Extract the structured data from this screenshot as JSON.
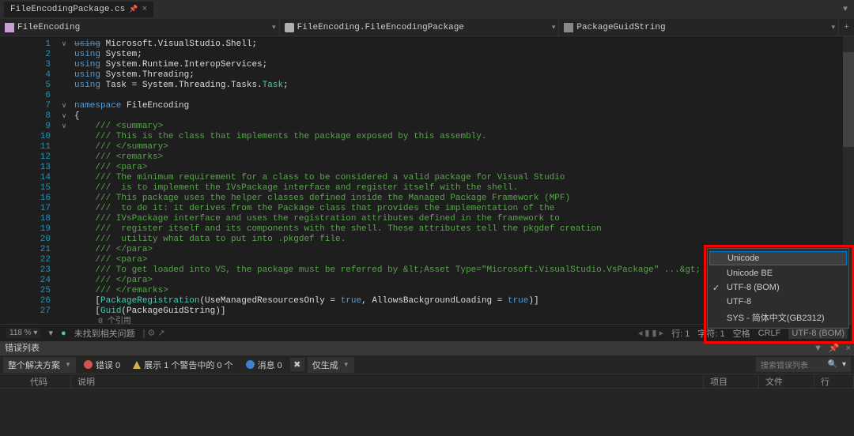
{
  "tab": {
    "name": "FileEncodingPackage.cs"
  },
  "nav": {
    "ns": "FileEncoding",
    "class": "FileEncoding.FileEncodingPackage",
    "member": "PackageGuidString"
  },
  "code": {
    "lines_count": 27,
    "refs_text": "0 个引用",
    "l1": {
      "u": "using",
      "ns": "Microsoft.VisualStudio.Shell"
    },
    "l2": {
      "u": "using",
      "ns": "System"
    },
    "l3": {
      "u": "using",
      "ns": "System.Runtime.InteropServices"
    },
    "l4": {
      "u": "using",
      "ns": "System.Threading"
    },
    "l5": {
      "u": "using",
      "a": "Task",
      "eq": "=",
      "ns": "System.Threading.Tasks.",
      "t": "Task"
    },
    "l7": {
      "kw": "namespace",
      "n": "FileEncoding"
    },
    "l8": "{",
    "c9": "/// <summary>",
    "c10": "/// This is the class that implements the package exposed by this assembly.",
    "c11": "/// </summary>",
    "c12": "/// <remarks>",
    "c13": "/// <para>",
    "c14": "/// The minimum requirement for a class to be considered a valid package for Visual Studio",
    "c15": "///  is to implement the IVsPackage interface and register itself with the shell.",
    "c16": "/// This package uses the helper classes defined inside the Managed Package Framework (MPF)",
    "c17": "///  to do it: it derives from the Package class that provides the implementation of the",
    "c18": "/// IVsPackage interface and uses the registration attributes defined in the framework to",
    "c19": "///  register itself and its components with the shell. These attributes tell the pkgdef creation",
    "c20": "///  utility what data to put into .pkgdef file.",
    "c21": "/// </para>",
    "c22": "/// <para>",
    "c23": "/// To get loaded into VS, the package must be referred by &lt;Asset Type=\"Microsoft.VisualStudio.VsPackage\" ...&gt; in .vsixmanifest file.",
    "c24": "/// </para>",
    "c25": "/// </remarks>",
    "l26": {
      "a1": "PackageRegistration",
      "p1": "UseManagedResourcesOnly",
      "t1": "true",
      "p2": "AllowsBackgroundLoading",
      "t2": "true"
    },
    "l27": {
      "a": "Guid",
      "p": "PackageGuidString"
    }
  },
  "encoding_menu": {
    "items": [
      {
        "label": "Unicode",
        "checked": false
      },
      {
        "label": "Unicode BE",
        "checked": false
      },
      {
        "label": "UTF-8 (BOM)",
        "checked": true
      },
      {
        "label": "UTF-8",
        "checked": false
      },
      {
        "label": "SYS - 简体中文(GB2312)",
        "checked": false
      }
    ]
  },
  "status": {
    "zoom": "118 %",
    "issues": "未找到相关问题",
    "line": "行: 1",
    "char": "字符: 1",
    "spaces": "空格",
    "eol": "CRLF",
    "enc": "UTF-8 (BOM)"
  },
  "error_list": {
    "title": "错误列表",
    "scope": "整个解决方案",
    "errors": "错误 0",
    "warnings": "展示 1 个警告中的 0 个",
    "messages": "消息 0",
    "build": "仅生成",
    "search_ph": "搜索错误列表",
    "cols": {
      "code": "代码",
      "desc": "说明",
      "project": "项目",
      "file": "文件",
      "line": "行"
    }
  }
}
